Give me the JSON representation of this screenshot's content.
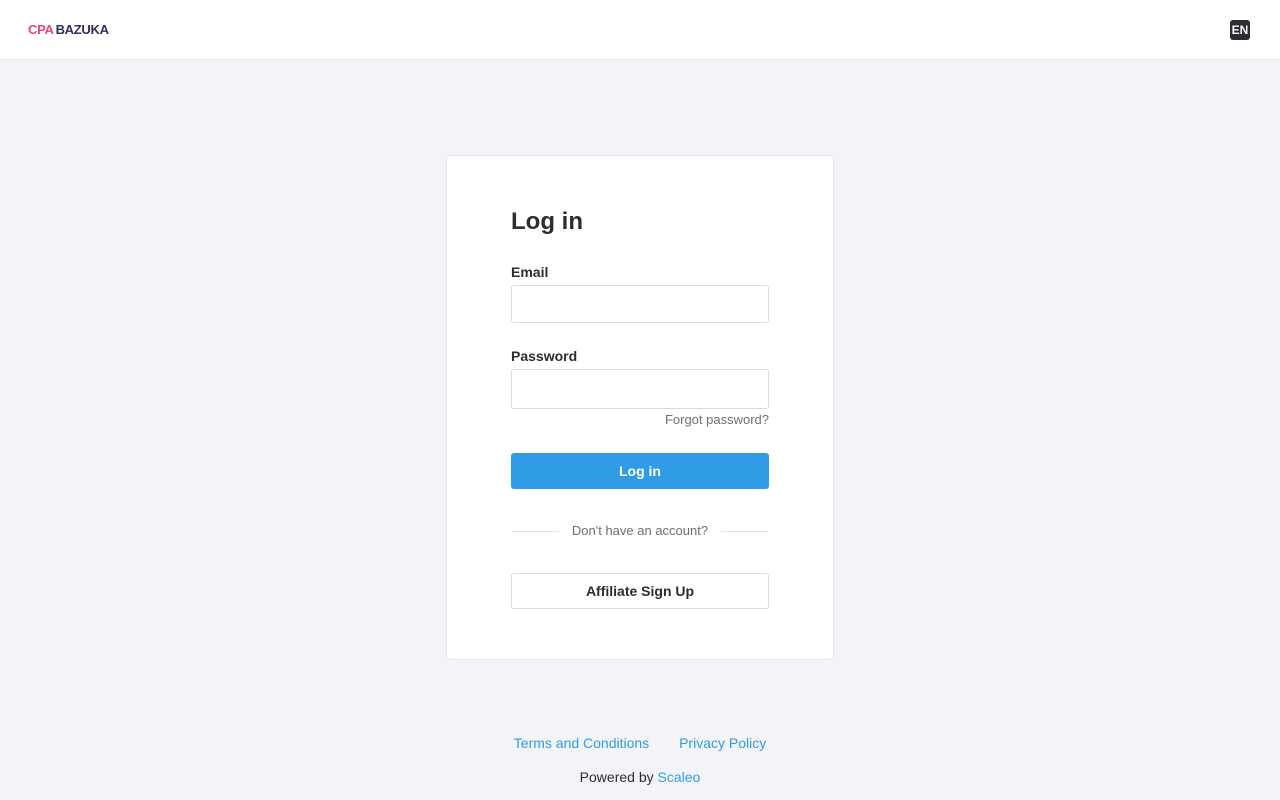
{
  "header": {
    "logo_part1": "CPA",
    "logo_part2": "BAZUKA",
    "language": "EN"
  },
  "login": {
    "title": "Log in",
    "email_label": "Email",
    "email_value": "",
    "password_label": "Password",
    "password_value": "",
    "forgot_password": "Forgot password?",
    "submit_label": "Log in",
    "divider_text": "Don't have an account?",
    "signup_label": "Affiliate Sign Up"
  },
  "footer": {
    "terms": "Terms and Conditions",
    "privacy": "Privacy Policy",
    "powered_prefix": "Powered by",
    "powered_brand": "Scaleo"
  },
  "colors": {
    "accent": "#319ce6",
    "logo_pink": "#e8457e",
    "logo_navy": "#2c2f5c",
    "background": "#f3f4f7"
  }
}
